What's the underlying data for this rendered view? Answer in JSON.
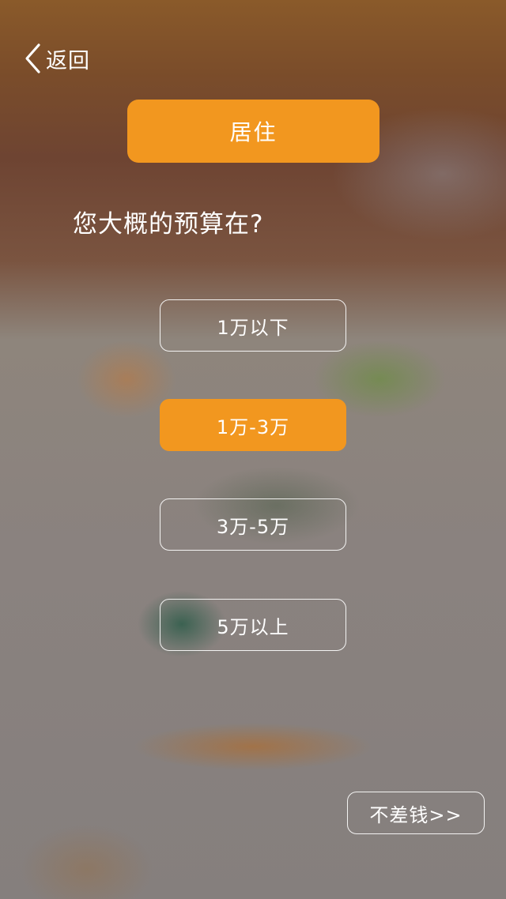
{
  "nav": {
    "back_label": "返回",
    "back_icon": "chevron-left-icon"
  },
  "category": {
    "label": "居住"
  },
  "question": {
    "text": "您大概的预算在?"
  },
  "options": [
    {
      "label": "1万以下",
      "selected": false
    },
    {
      "label": "1万-3万",
      "selected": true
    },
    {
      "label": "3万-5万",
      "selected": false
    },
    {
      "label": "5万以上",
      "selected": false
    }
  ],
  "skip": {
    "label": "不差钱>>"
  },
  "colors": {
    "accent": "#f2971f",
    "text": "#ffffff"
  }
}
